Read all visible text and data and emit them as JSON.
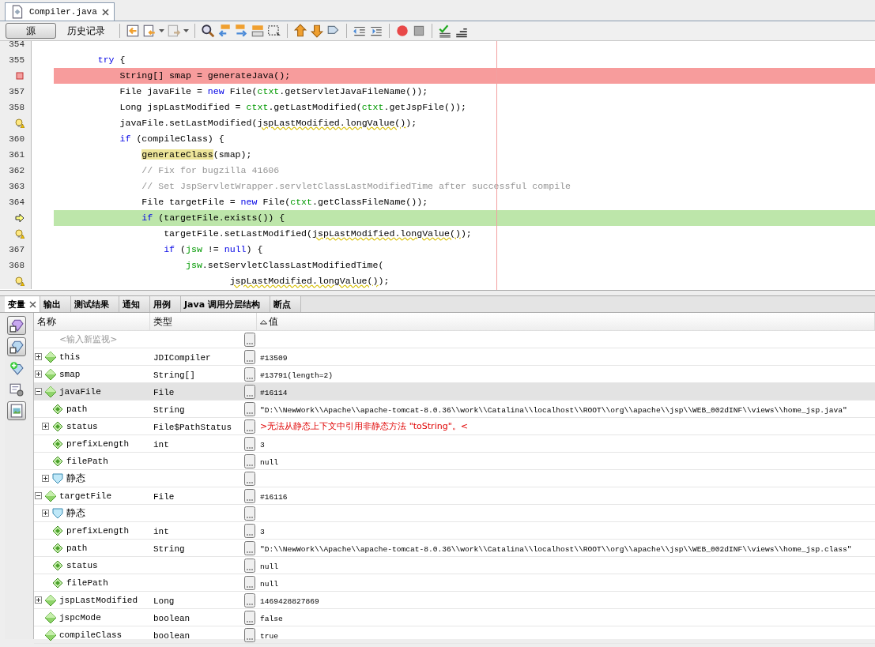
{
  "editor_tab": {
    "title": "Compiler.java",
    "selected": true
  },
  "view_buttons": [
    {
      "label": "源",
      "selected": true
    },
    {
      "label": "历史记录",
      "selected": false
    }
  ],
  "code_lines": [
    {
      "number": "354",
      "kind": "plain"
    },
    {
      "number": "355",
      "kind": "plain",
      "segments": [
        {
          "text": "        try",
          "kind": "keyword"
        },
        {
          "text": " {",
          "kind": "plain"
        }
      ]
    },
    {
      "kind": "breakpoint",
      "segments": [
        {
          "text": "            String[] smap = generateJava();",
          "kind": "plain"
        }
      ]
    },
    {
      "number": "357",
      "kind": "plain",
      "segments": [
        {
          "text": "            File javaFile = ",
          "kind": "plain"
        },
        {
          "text": "new",
          "kind": "keyword"
        },
        {
          "text": " File(",
          "kind": "plain"
        },
        {
          "text": "ctxt",
          "kind": "field"
        },
        {
          "text": ".getServletJavaFileName());",
          "kind": "plain"
        }
      ]
    },
    {
      "number": "358",
      "kind": "plain",
      "segments": [
        {
          "text": "            Long jspLastModified = ",
          "kind": "plain"
        },
        {
          "text": "ctxt",
          "kind": "field"
        },
        {
          "text": ".getLastModified(",
          "kind": "plain"
        },
        {
          "text": "ctxt",
          "kind": "field"
        },
        {
          "text": ".getJspFile());",
          "kind": "plain"
        }
      ]
    },
    {
      "kind": "warning",
      "segments": [
        {
          "text": "            javaFile.setLastModified(",
          "kind": "plain"
        },
        {
          "text": "jspLastModified.longValue()",
          "kind": "warn"
        },
        {
          "text": ");",
          "kind": "plain"
        }
      ]
    },
    {
      "number": "360",
      "kind": "plain",
      "segments": [
        {
          "text": "            if",
          "kind": "keyword"
        },
        {
          "text": " (compileClass) {",
          "kind": "plain"
        }
      ]
    },
    {
      "number": "361",
      "kind": "plain",
      "segments": [
        {
          "text": "                generateClass",
          "kind": "mark"
        },
        {
          "text": "(smap);",
          "kind": "plain"
        }
      ]
    },
    {
      "number": "362",
      "kind": "plain",
      "segments": [
        {
          "text": "                // Fix for bugzilla 41606",
          "kind": "comment"
        }
      ]
    },
    {
      "number": "363",
      "kind": "plain",
      "segments": [
        {
          "text": "                // Set JspServletWrapper.servletClassLastModifiedTime after successful compile",
          "kind": "comment"
        }
      ]
    },
    {
      "number": "364",
      "kind": "plain",
      "segments": [
        {
          "text": "                File targetFile = ",
          "kind": "plain"
        },
        {
          "text": "new",
          "kind": "keyword"
        },
        {
          "text": " File(",
          "kind": "plain"
        },
        {
          "text": "ctxt",
          "kind": "field"
        },
        {
          "text": ".getClassFileName());",
          "kind": "plain"
        }
      ]
    },
    {
      "kind": "current",
      "segments": [
        {
          "text": "                if",
          "kind": "keyword"
        },
        {
          "text": " (targetFile.exists()) {",
          "kind": "plain"
        }
      ]
    },
    {
      "kind": "warning",
      "segments": [
        {
          "text": "                    targetFile.setLastModified(",
          "kind": "plain"
        },
        {
          "text": "jspLastModified.longValue()",
          "kind": "warn"
        },
        {
          "text": ");",
          "kind": "plain"
        }
      ]
    },
    {
      "number": "367",
      "kind": "plain",
      "segments": [
        {
          "text": "                    if",
          "kind": "keyword"
        },
        {
          "text": " (",
          "kind": "plain"
        },
        {
          "text": "jsw",
          "kind": "field"
        },
        {
          "text": " != ",
          "kind": "plain"
        },
        {
          "text": "null",
          "kind": "keyword"
        },
        {
          "text": ") {",
          "kind": "plain"
        }
      ]
    },
    {
      "number": "368",
      "kind": "plain",
      "segments": [
        {
          "text": "                        jsw",
          "kind": "field"
        },
        {
          "text": ".setServletClassLastModifiedTime(",
          "kind": "plain"
        }
      ]
    },
    {
      "kind": "warning",
      "segments": [
        {
          "text": "                                jspLastModified.longValue()",
          "kind": "warn"
        },
        {
          "text": ");",
          "kind": "plain"
        }
      ]
    }
  ],
  "panel_tabs": [
    {
      "label": "变量",
      "selected": true
    },
    {
      "label": "输出",
      "selected": false
    },
    {
      "label": "测试结果",
      "selected": false
    },
    {
      "label": "通知",
      "selected": false
    },
    {
      "label": "用例",
      "selected": false
    },
    {
      "label": "Java 调用分层结构",
      "selected": false
    },
    {
      "label": "断点",
      "selected": false
    }
  ],
  "side_tools": [
    {
      "on": true
    },
    {
      "on": true
    },
    {
      "on": false
    },
    {
      "on": false
    },
    {
      "on": true
    }
  ],
  "columns": [
    {
      "label": "名称",
      "sorted": false
    },
    {
      "label": "类型",
      "sorted": false
    },
    {
      "label": "值",
      "sorted": true
    }
  ],
  "watch_placeholder": "<输入新监视>",
  "variables": [
    {
      "name": "this",
      "type": "JDICompiler",
      "value": "#13509",
      "kind": "variable",
      "expanded": false,
      "selected": false
    },
    {
      "name": "smap",
      "type": "String[]",
      "value": "#13791(length=2)",
      "kind": "variable",
      "expanded": false,
      "selected": false
    },
    {
      "name": "javaFile",
      "type": "File",
      "value": "#16114",
      "kind": "variable",
      "expanded": true,
      "selected": true,
      "children": [
        {
          "name": "path",
          "type": "String",
          "value": "\"D:\\\\NewWork\\\\Apache\\\\apache-tomcat-8.0.36\\\\work\\\\Catalina\\\\localhost\\\\ROOT\\\\org\\\\apache\\\\jsp\\\\WEB_002dINF\\\\views\\\\home_jsp.java\"",
          "kind": "field",
          "selected": false
        },
        {
          "name": "status",
          "type": "File$PathStatus",
          "value": ">无法从静态上下文中引用非静态方法 \"toString\"。<",
          "kind": "field",
          "expanded": false,
          "selected": false,
          "error": true
        },
        {
          "name": "prefixLength",
          "type": "int",
          "value": "3",
          "kind": "field",
          "selected": false
        },
        {
          "name": "filePath",
          "value": "null",
          "kind": "field",
          "selected": false
        },
        {
          "name": "静态",
          "kind": "static",
          "expanded": false,
          "selected": false
        }
      ]
    },
    {
      "name": "targetFile",
      "type": "File",
      "value": "#16116",
      "kind": "variable",
      "expanded": true,
      "selected": false,
      "children": [
        {
          "name": "静态",
          "kind": "static",
          "expanded": false,
          "selected": false
        },
        {
          "name": "prefixLength",
          "type": "int",
          "value": "3",
          "kind": "field",
          "selected": false
        },
        {
          "name": "path",
          "type": "String",
          "value": "\"D:\\\\NewWork\\\\Apache\\\\apache-tomcat-8.0.36\\\\work\\\\Catalina\\\\localhost\\\\ROOT\\\\org\\\\apache\\\\jsp\\\\WEB_002dINF\\\\views\\\\home_jsp.class\"",
          "kind": "field",
          "selected": false
        },
        {
          "name": "status",
          "value": "null",
          "kind": "field",
          "selected": false
        },
        {
          "name": "filePath",
          "value": "null",
          "kind": "field",
          "selected": false
        }
      ]
    },
    {
      "name": "jspLastModified",
      "type": "Long",
      "value": "1469428827869",
      "kind": "variable",
      "expanded": false,
      "selected": false
    },
    {
      "name": "jspcMode",
      "type": "boolean",
      "value": "false",
      "kind": "variable",
      "selected": false
    },
    {
      "name": "compileClass",
      "type": "boolean",
      "value": "true",
      "kind": "variable",
      "selected": false
    }
  ]
}
